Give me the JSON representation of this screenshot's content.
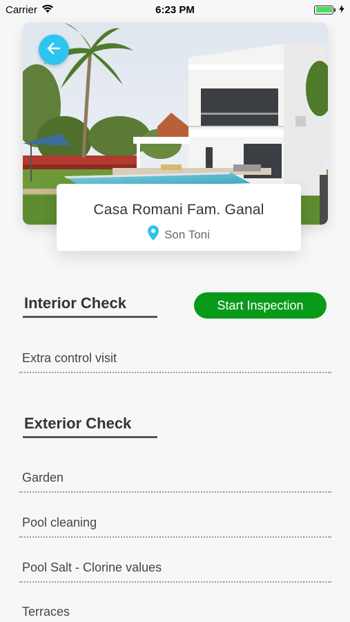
{
  "status_bar": {
    "carrier": "Carrier",
    "time": "6:23 PM",
    "wifi_icon": "wifi-icon",
    "battery_icon": "battery-icon",
    "charging_icon": "bolt-icon",
    "battery_color": "#4cd964"
  },
  "hero": {
    "image": "villa-with-pool-photo",
    "back_icon": "arrow-left-icon",
    "back_button_color": "#2ec4f0"
  },
  "property": {
    "name": "Casa Romani Fam. Ganal",
    "location": "Son Toni",
    "location_icon": "map-pin-icon",
    "pin_color": "#2ec4f0"
  },
  "interior": {
    "title": "Interior Check",
    "start_button": "Start Inspection",
    "button_color": "#0a9a1a",
    "items": [
      {
        "label": "Extra control visit"
      }
    ]
  },
  "exterior": {
    "title": "Exterior Check",
    "items": [
      {
        "label": "Garden"
      },
      {
        "label": "Pool cleaning"
      },
      {
        "label": "Pool Salt - Clorine values"
      },
      {
        "label": "Terraces"
      }
    ]
  }
}
